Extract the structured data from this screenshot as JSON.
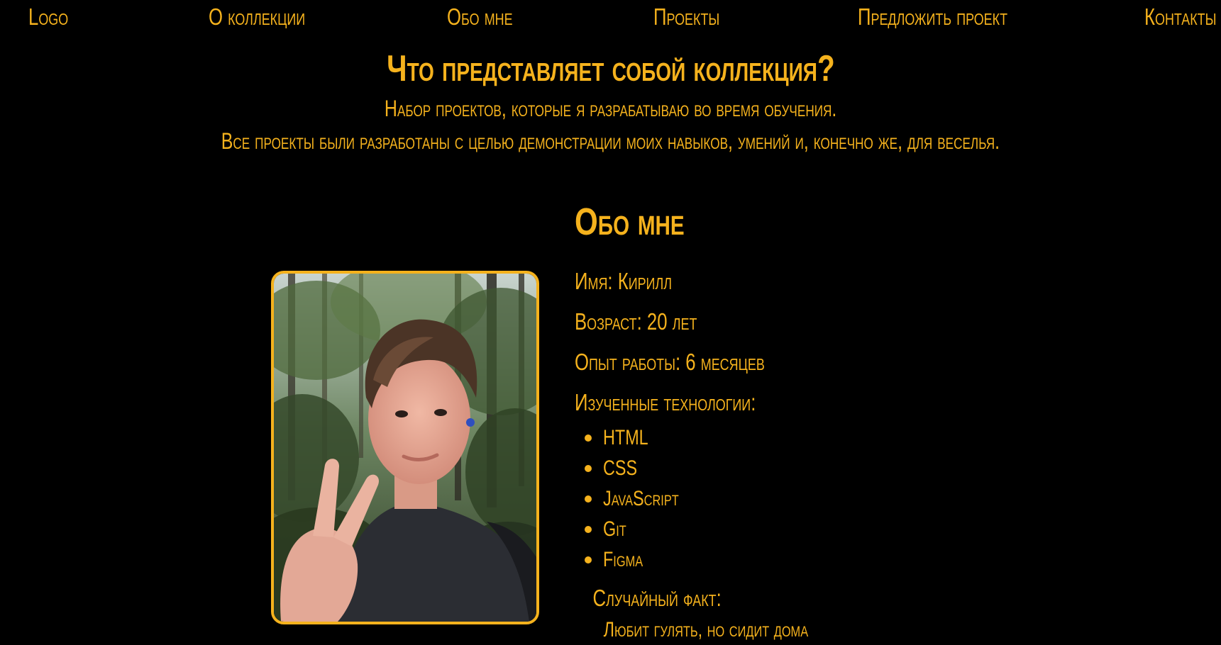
{
  "nav": {
    "logo": "Logo",
    "collection": "О коллекции",
    "about": "Обо мне",
    "projects": "Проекты",
    "suggest": "Предложить проект",
    "contacts": "Контакты"
  },
  "collection": {
    "title": "Что представляет собой коллекция?",
    "line1": "Набор проектов, которые я разрабатываю во время обучения.",
    "line2": "Все проекты были разработаны с целью демонстрации моих навыков, умений и, конечно же, для веселья."
  },
  "about": {
    "title": "Обо мне",
    "name": "Имя: Кирилл",
    "age": "Возраст: 20 лет",
    "experience": "Опыт работы: 6 месяцев",
    "tech_title": "Изученные технологии:",
    "technologies": [
      "HTML",
      "CSS",
      "JavaScript",
      "Git",
      "Figma"
    ],
    "fact_title": "Случайный факт:",
    "fact": "Любит гулять, но сидит дома"
  },
  "colors": {
    "accent": "#f5b21d",
    "background": "#000000"
  }
}
